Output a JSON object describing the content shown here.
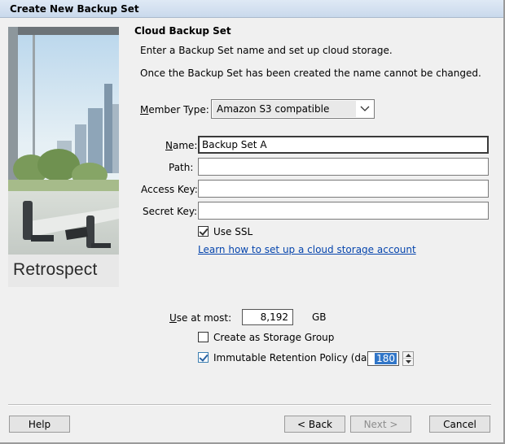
{
  "window": {
    "title": "Create New Backup Set"
  },
  "brand": {
    "name": "Retrospect"
  },
  "section": {
    "title": "Cloud Backup Set",
    "instruction1": "Enter a Backup Set name and set up cloud storage.",
    "instruction2": "Once the Backup Set has been created the name cannot be changed."
  },
  "form": {
    "member_type_label": "Member Type:",
    "member_type_value": "Amazon S3 compatible",
    "name_label": "Name:",
    "name_value": "Backup Set A",
    "path_label": "Path:",
    "path_value": "",
    "access_key_label": "Access Key:",
    "access_key_value": "",
    "secret_key_label": "Secret Key:",
    "secret_key_value": "",
    "use_ssl_label": "Use SSL",
    "use_ssl_checked": true,
    "help_link": "Learn how to set up a cloud storage account",
    "use_at_most_label": "Use at most:",
    "use_at_most_value": "8,192",
    "use_at_most_unit": "GB",
    "storage_group_label": "Create as Storage Group",
    "storage_group_checked": false,
    "immutable_label": "Immutable Retention Policy (days)",
    "immutable_checked": true,
    "immutable_days": "180"
  },
  "buttons": {
    "help": "Help",
    "back": "< Back",
    "next": "Next >",
    "cancel": "Cancel"
  },
  "icons": {
    "combo_arrow": "chevron-down-icon",
    "spin_up": "spin-up-icon",
    "spin_down": "spin-down-icon"
  }
}
